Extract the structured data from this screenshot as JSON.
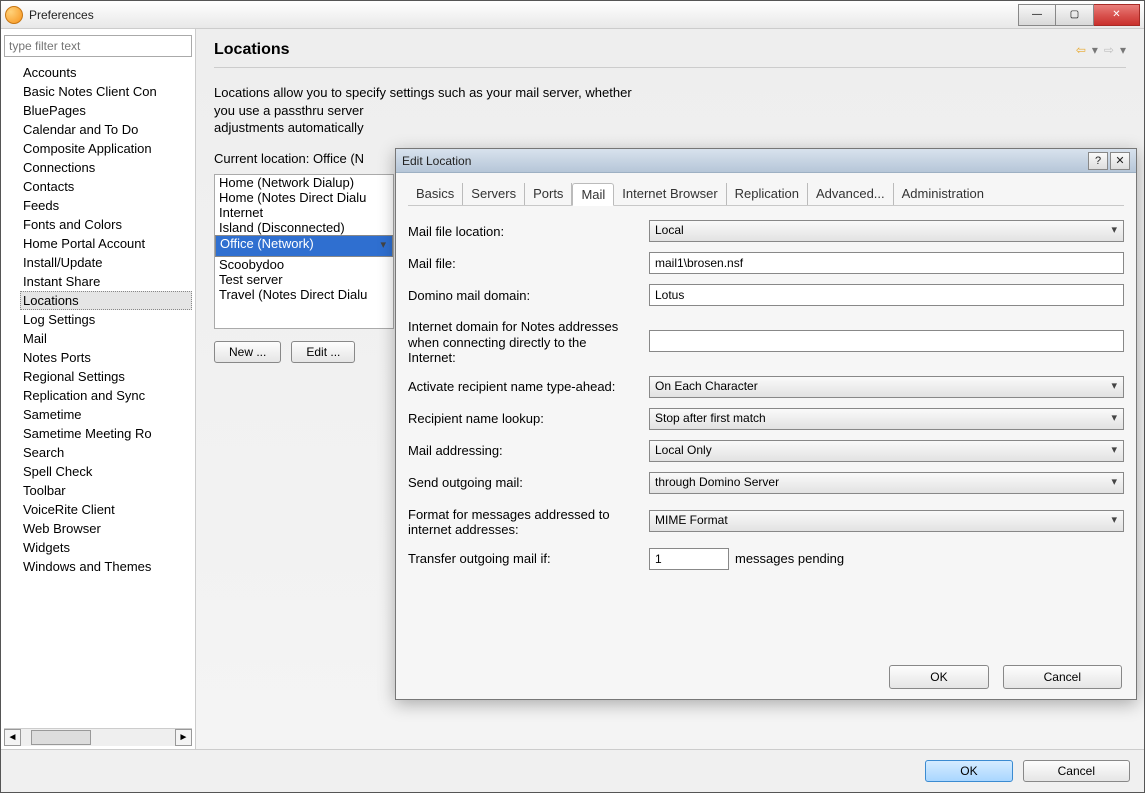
{
  "window": {
    "title": "Preferences"
  },
  "filter_placeholder": "type filter text",
  "tree": [
    "Accounts",
    "Basic Notes Client Con",
    "BluePages",
    "Calendar and To Do",
    "Composite Application",
    "Connections",
    "Contacts",
    "Feeds",
    "Fonts and Colors",
    "Home Portal Account",
    "Install/Update",
    "Instant Share",
    "Locations",
    "Log Settings",
    "Mail",
    "Notes Ports",
    "Regional Settings",
    "Replication and Sync",
    "Sametime",
    "Sametime Meeting Ro",
    "Search",
    "Spell Check",
    "Toolbar",
    "VoiceRite Client",
    "Web Browser",
    "Widgets",
    "Windows and Themes"
  ],
  "tree_selected": "Locations",
  "main": {
    "heading": "Locations",
    "desc_line1": "Locations allow you to specify settings such as your mail server, whether",
    "desc_line2": "you use a passthru server",
    "desc_line3": "adjustments automatically",
    "current_label": "Current location: Office (N",
    "locations": [
      "Home (Network Dialup)",
      "Home (Notes Direct Dialu",
      "Internet",
      "Island (Disconnected)",
      "Office (Network)",
      "Scoobydoo",
      "Test server",
      "Travel (Notes Direct Dialu"
    ],
    "locations_selected": "Office (Network)",
    "btn_new": "New ...",
    "btn_edit": "Edit ..."
  },
  "footer": {
    "ok": "OK",
    "cancel": "Cancel"
  },
  "modal": {
    "title": "Edit Location",
    "tabs": [
      "Basics",
      "Servers",
      "Ports",
      "Mail",
      "Internet Browser",
      "Replication",
      "Advanced...",
      "Administration"
    ],
    "active_tab": "Mail",
    "fields": {
      "mail_file_location": {
        "label": "Mail file location:",
        "value": "Local",
        "type": "select"
      },
      "mail_file": {
        "label": "Mail file:",
        "value": "mail1\\brosen.nsf",
        "type": "text"
      },
      "domino_domain": {
        "label": "Domino mail domain:",
        "value": "Lotus",
        "type": "text"
      },
      "internet_domain": {
        "label": "Internet domain for Notes addresses when connecting directly to the Internet:",
        "value": "",
        "type": "text"
      },
      "typeahead": {
        "label": "Activate recipient name type-ahead:",
        "value": "On Each Character",
        "type": "select"
      },
      "lookup": {
        "label": "Recipient name lookup:",
        "value": "Stop after first match",
        "type": "select"
      },
      "addressing": {
        "label": "Mail addressing:",
        "value": "Local Only",
        "type": "select"
      },
      "send_outgoing": {
        "label": "Send outgoing mail:",
        "value": "through Domino Server",
        "type": "select"
      },
      "format": {
        "label": "Format for messages addressed to internet addresses:",
        "value": "MIME Format",
        "type": "select"
      },
      "transfer_if": {
        "label": "Transfer outgoing mail if:",
        "value": "1",
        "suffix": "messages pending"
      }
    },
    "ok": "OK",
    "cancel": "Cancel"
  }
}
